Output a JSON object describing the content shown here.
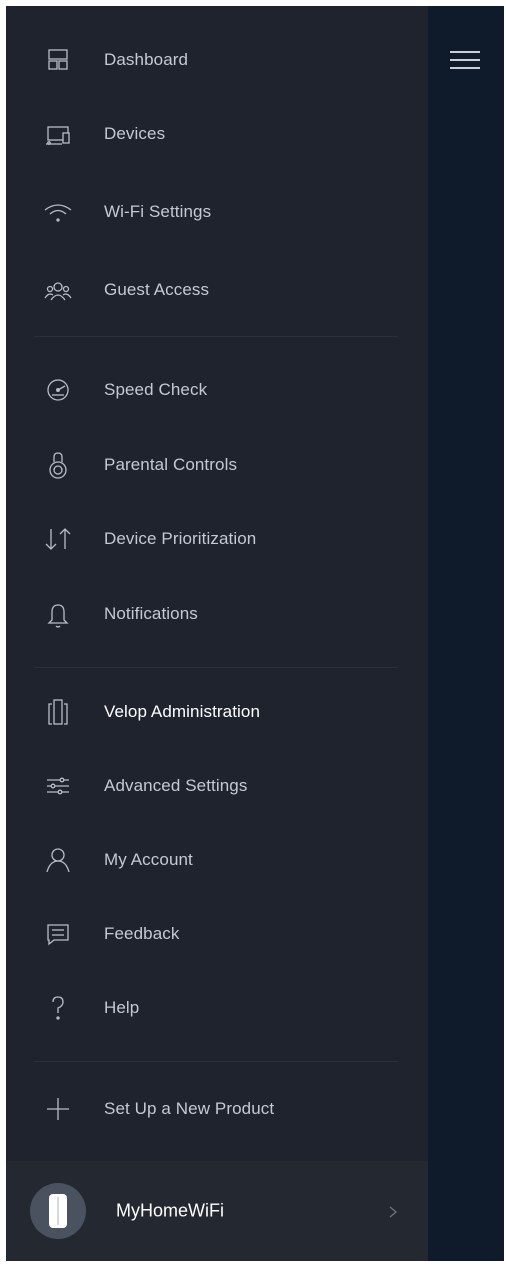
{
  "menu": {
    "items": [
      {
        "label": "Dashboard",
        "icon": "dashboard-icon"
      },
      {
        "label": "Devices",
        "icon": "devices-icon"
      },
      {
        "label": "Wi-Fi Settings",
        "icon": "wifi-icon"
      },
      {
        "label": "Guest Access",
        "icon": "guest-access-icon"
      },
      {
        "label": "Speed Check",
        "icon": "speedometer-icon"
      },
      {
        "label": "Parental Controls",
        "icon": "padlock-icon"
      },
      {
        "label": "Device Prioritization",
        "icon": "priority-arrows-icon"
      },
      {
        "label": "Notifications",
        "icon": "bell-icon"
      },
      {
        "label": "Velop Administration",
        "icon": "velop-nodes-icon"
      },
      {
        "label": "Advanced Settings",
        "icon": "sliders-icon"
      },
      {
        "label": "My Account",
        "icon": "user-icon"
      },
      {
        "label": "Feedback",
        "icon": "feedback-icon"
      },
      {
        "label": "Help",
        "icon": "help-icon"
      },
      {
        "label": "Set Up a New Product",
        "icon": "plus-icon"
      }
    ],
    "active_item": "Velop Administration"
  },
  "network": {
    "name": "MyHomeWiFi",
    "icon": "velop-node-icon"
  },
  "header": {
    "menu_icon": "hamburger-menu-icon"
  },
  "colors": {
    "menu_background": "#1e232e",
    "side_panel": "#0f1a2a",
    "text": "#c4c9d2",
    "active_text": "#ffffff",
    "divider": "#2b313c",
    "network_bar": "#232831"
  }
}
